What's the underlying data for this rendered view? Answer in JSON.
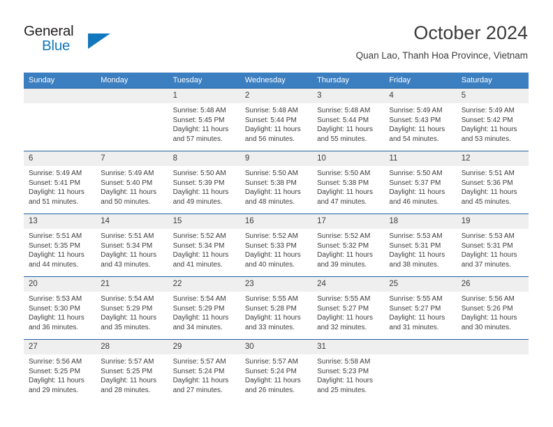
{
  "brand": {
    "name_top": "General",
    "name_bottom": "Blue",
    "triangle_color": "#1277bc"
  },
  "header": {
    "month_title": "October 2024",
    "location": "Quan Lao, Thanh Hoa Province, Vietnam"
  },
  "theme": {
    "header_bg": "#3c7fc1",
    "header_text": "#ffffff",
    "row_divider": "#1f5fa0",
    "daynum_bg": "#efefef",
    "body_text": "#3c3c3c"
  },
  "weekday_headers": [
    "Sunday",
    "Monday",
    "Tuesday",
    "Wednesday",
    "Thursday",
    "Friday",
    "Saturday"
  ],
  "labels": {
    "sunrise_prefix": "Sunrise:",
    "sunset_prefix": "Sunset:",
    "daylight_prefix": "Daylight:"
  },
  "weeks": [
    [
      {
        "day": "",
        "empty": true,
        "lines": []
      },
      {
        "day": "",
        "empty": true,
        "lines": []
      },
      {
        "day": "1",
        "lines": [
          "Sunrise: 5:48 AM",
          "Sunset: 5:45 PM",
          "Daylight: 11 hours",
          "and 57 minutes."
        ]
      },
      {
        "day": "2",
        "lines": [
          "Sunrise: 5:48 AM",
          "Sunset: 5:44 PM",
          "Daylight: 11 hours",
          "and 56 minutes."
        ]
      },
      {
        "day": "3",
        "lines": [
          "Sunrise: 5:48 AM",
          "Sunset: 5:44 PM",
          "Daylight: 11 hours",
          "and 55 minutes."
        ]
      },
      {
        "day": "4",
        "lines": [
          "Sunrise: 5:49 AM",
          "Sunset: 5:43 PM",
          "Daylight: 11 hours",
          "and 54 minutes."
        ]
      },
      {
        "day": "5",
        "lines": [
          "Sunrise: 5:49 AM",
          "Sunset: 5:42 PM",
          "Daylight: 11 hours",
          "and 53 minutes."
        ]
      }
    ],
    [
      {
        "day": "6",
        "lines": [
          "Sunrise: 5:49 AM",
          "Sunset: 5:41 PM",
          "Daylight: 11 hours",
          "and 51 minutes."
        ]
      },
      {
        "day": "7",
        "lines": [
          "Sunrise: 5:49 AM",
          "Sunset: 5:40 PM",
          "Daylight: 11 hours",
          "and 50 minutes."
        ]
      },
      {
        "day": "8",
        "lines": [
          "Sunrise: 5:50 AM",
          "Sunset: 5:39 PM",
          "Daylight: 11 hours",
          "and 49 minutes."
        ]
      },
      {
        "day": "9",
        "lines": [
          "Sunrise: 5:50 AM",
          "Sunset: 5:38 PM",
          "Daylight: 11 hours",
          "and 48 minutes."
        ]
      },
      {
        "day": "10",
        "lines": [
          "Sunrise: 5:50 AM",
          "Sunset: 5:38 PM",
          "Daylight: 11 hours",
          "and 47 minutes."
        ]
      },
      {
        "day": "11",
        "lines": [
          "Sunrise: 5:50 AM",
          "Sunset: 5:37 PM",
          "Daylight: 11 hours",
          "and 46 minutes."
        ]
      },
      {
        "day": "12",
        "lines": [
          "Sunrise: 5:51 AM",
          "Sunset: 5:36 PM",
          "Daylight: 11 hours",
          "and 45 minutes."
        ]
      }
    ],
    [
      {
        "day": "13",
        "lines": [
          "Sunrise: 5:51 AM",
          "Sunset: 5:35 PM",
          "Daylight: 11 hours",
          "and 44 minutes."
        ]
      },
      {
        "day": "14",
        "lines": [
          "Sunrise: 5:51 AM",
          "Sunset: 5:34 PM",
          "Daylight: 11 hours",
          "and 43 minutes."
        ]
      },
      {
        "day": "15",
        "lines": [
          "Sunrise: 5:52 AM",
          "Sunset: 5:34 PM",
          "Daylight: 11 hours",
          "and 41 minutes."
        ]
      },
      {
        "day": "16",
        "lines": [
          "Sunrise: 5:52 AM",
          "Sunset: 5:33 PM",
          "Daylight: 11 hours",
          "and 40 minutes."
        ]
      },
      {
        "day": "17",
        "lines": [
          "Sunrise: 5:52 AM",
          "Sunset: 5:32 PM",
          "Daylight: 11 hours",
          "and 39 minutes."
        ]
      },
      {
        "day": "18",
        "lines": [
          "Sunrise: 5:53 AM",
          "Sunset: 5:31 PM",
          "Daylight: 11 hours",
          "and 38 minutes."
        ]
      },
      {
        "day": "19",
        "lines": [
          "Sunrise: 5:53 AM",
          "Sunset: 5:31 PM",
          "Daylight: 11 hours",
          "and 37 minutes."
        ]
      }
    ],
    [
      {
        "day": "20",
        "lines": [
          "Sunrise: 5:53 AM",
          "Sunset: 5:30 PM",
          "Daylight: 11 hours",
          "and 36 minutes."
        ]
      },
      {
        "day": "21",
        "lines": [
          "Sunrise: 5:54 AM",
          "Sunset: 5:29 PM",
          "Daylight: 11 hours",
          "and 35 minutes."
        ]
      },
      {
        "day": "22",
        "lines": [
          "Sunrise: 5:54 AM",
          "Sunset: 5:29 PM",
          "Daylight: 11 hours",
          "and 34 minutes."
        ]
      },
      {
        "day": "23",
        "lines": [
          "Sunrise: 5:55 AM",
          "Sunset: 5:28 PM",
          "Daylight: 11 hours",
          "and 33 minutes."
        ]
      },
      {
        "day": "24",
        "lines": [
          "Sunrise: 5:55 AM",
          "Sunset: 5:27 PM",
          "Daylight: 11 hours",
          "and 32 minutes."
        ]
      },
      {
        "day": "25",
        "lines": [
          "Sunrise: 5:55 AM",
          "Sunset: 5:27 PM",
          "Daylight: 11 hours",
          "and 31 minutes."
        ]
      },
      {
        "day": "26",
        "lines": [
          "Sunrise: 5:56 AM",
          "Sunset: 5:26 PM",
          "Daylight: 11 hours",
          "and 30 minutes."
        ]
      }
    ],
    [
      {
        "day": "27",
        "lines": [
          "Sunrise: 5:56 AM",
          "Sunset: 5:25 PM",
          "Daylight: 11 hours",
          "and 29 minutes."
        ]
      },
      {
        "day": "28",
        "lines": [
          "Sunrise: 5:57 AM",
          "Sunset: 5:25 PM",
          "Daylight: 11 hours",
          "and 28 minutes."
        ]
      },
      {
        "day": "29",
        "lines": [
          "Sunrise: 5:57 AM",
          "Sunset: 5:24 PM",
          "Daylight: 11 hours",
          "and 27 minutes."
        ]
      },
      {
        "day": "30",
        "lines": [
          "Sunrise: 5:57 AM",
          "Sunset: 5:24 PM",
          "Daylight: 11 hours",
          "and 26 minutes."
        ]
      },
      {
        "day": "31",
        "lines": [
          "Sunrise: 5:58 AM",
          "Sunset: 5:23 PM",
          "Daylight: 11 hours",
          "and 25 minutes."
        ]
      },
      {
        "day": "",
        "empty": true,
        "lines": []
      },
      {
        "day": "",
        "empty": true,
        "lines": []
      }
    ]
  ]
}
